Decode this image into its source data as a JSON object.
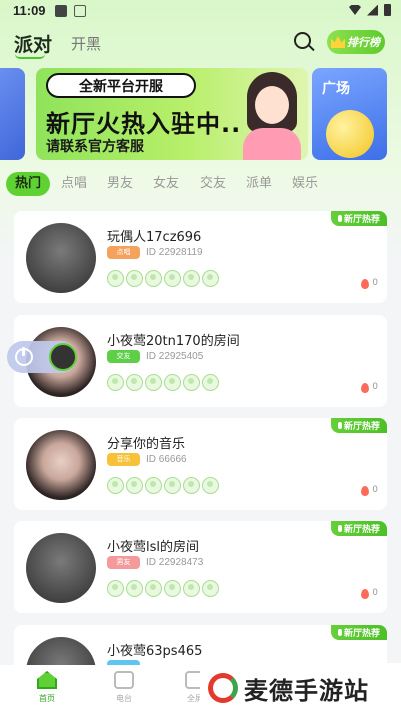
{
  "status_bar": {
    "time": "11:09"
  },
  "header": {
    "logo": "派对",
    "tab_black": "开黑",
    "rank_label": "排行榜"
  },
  "banner": {
    "tag": "全新平台开服",
    "title": "新厅火热入驻中..",
    "subtitle": "请联系官方客服",
    "side_label": "广场"
  },
  "categories": [
    "热门",
    "点唱",
    "男友",
    "女友",
    "交友",
    "派单",
    "娱乐"
  ],
  "badge_text": "新厅热荐",
  "rooms": [
    {
      "name": "玩偶人17cz696",
      "tag": "点唱",
      "tag_color": "#f5a25d",
      "id": "ID 22928119",
      "heat": "0"
    },
    {
      "name": "小夜莺20tn170的房间",
      "tag": "交友",
      "tag_color": "#5fcf4a",
      "id": "ID 22925405",
      "heat": "0"
    },
    {
      "name": "分享你的音乐",
      "tag": "音乐",
      "tag_color": "#f7c23a",
      "id": "ID 66666",
      "heat": "0"
    },
    {
      "name": "小夜莺lsl的房间",
      "tag": "男友",
      "tag_color": "#f59a9a",
      "id": "ID 22928473",
      "heat": "0"
    },
    {
      "name": "小夜莺63ps465",
      "tag": "",
      "tag_color": "#5cc6f0",
      "id": "",
      "heat": ""
    }
  ],
  "bottom_nav": {
    "home": "首页",
    "radio": "电台",
    "plaza": "全屏"
  },
  "watermark": "麦德手游站",
  "colors": {
    "accent": "#5fd133",
    "card_bg": "#ffffff"
  }
}
